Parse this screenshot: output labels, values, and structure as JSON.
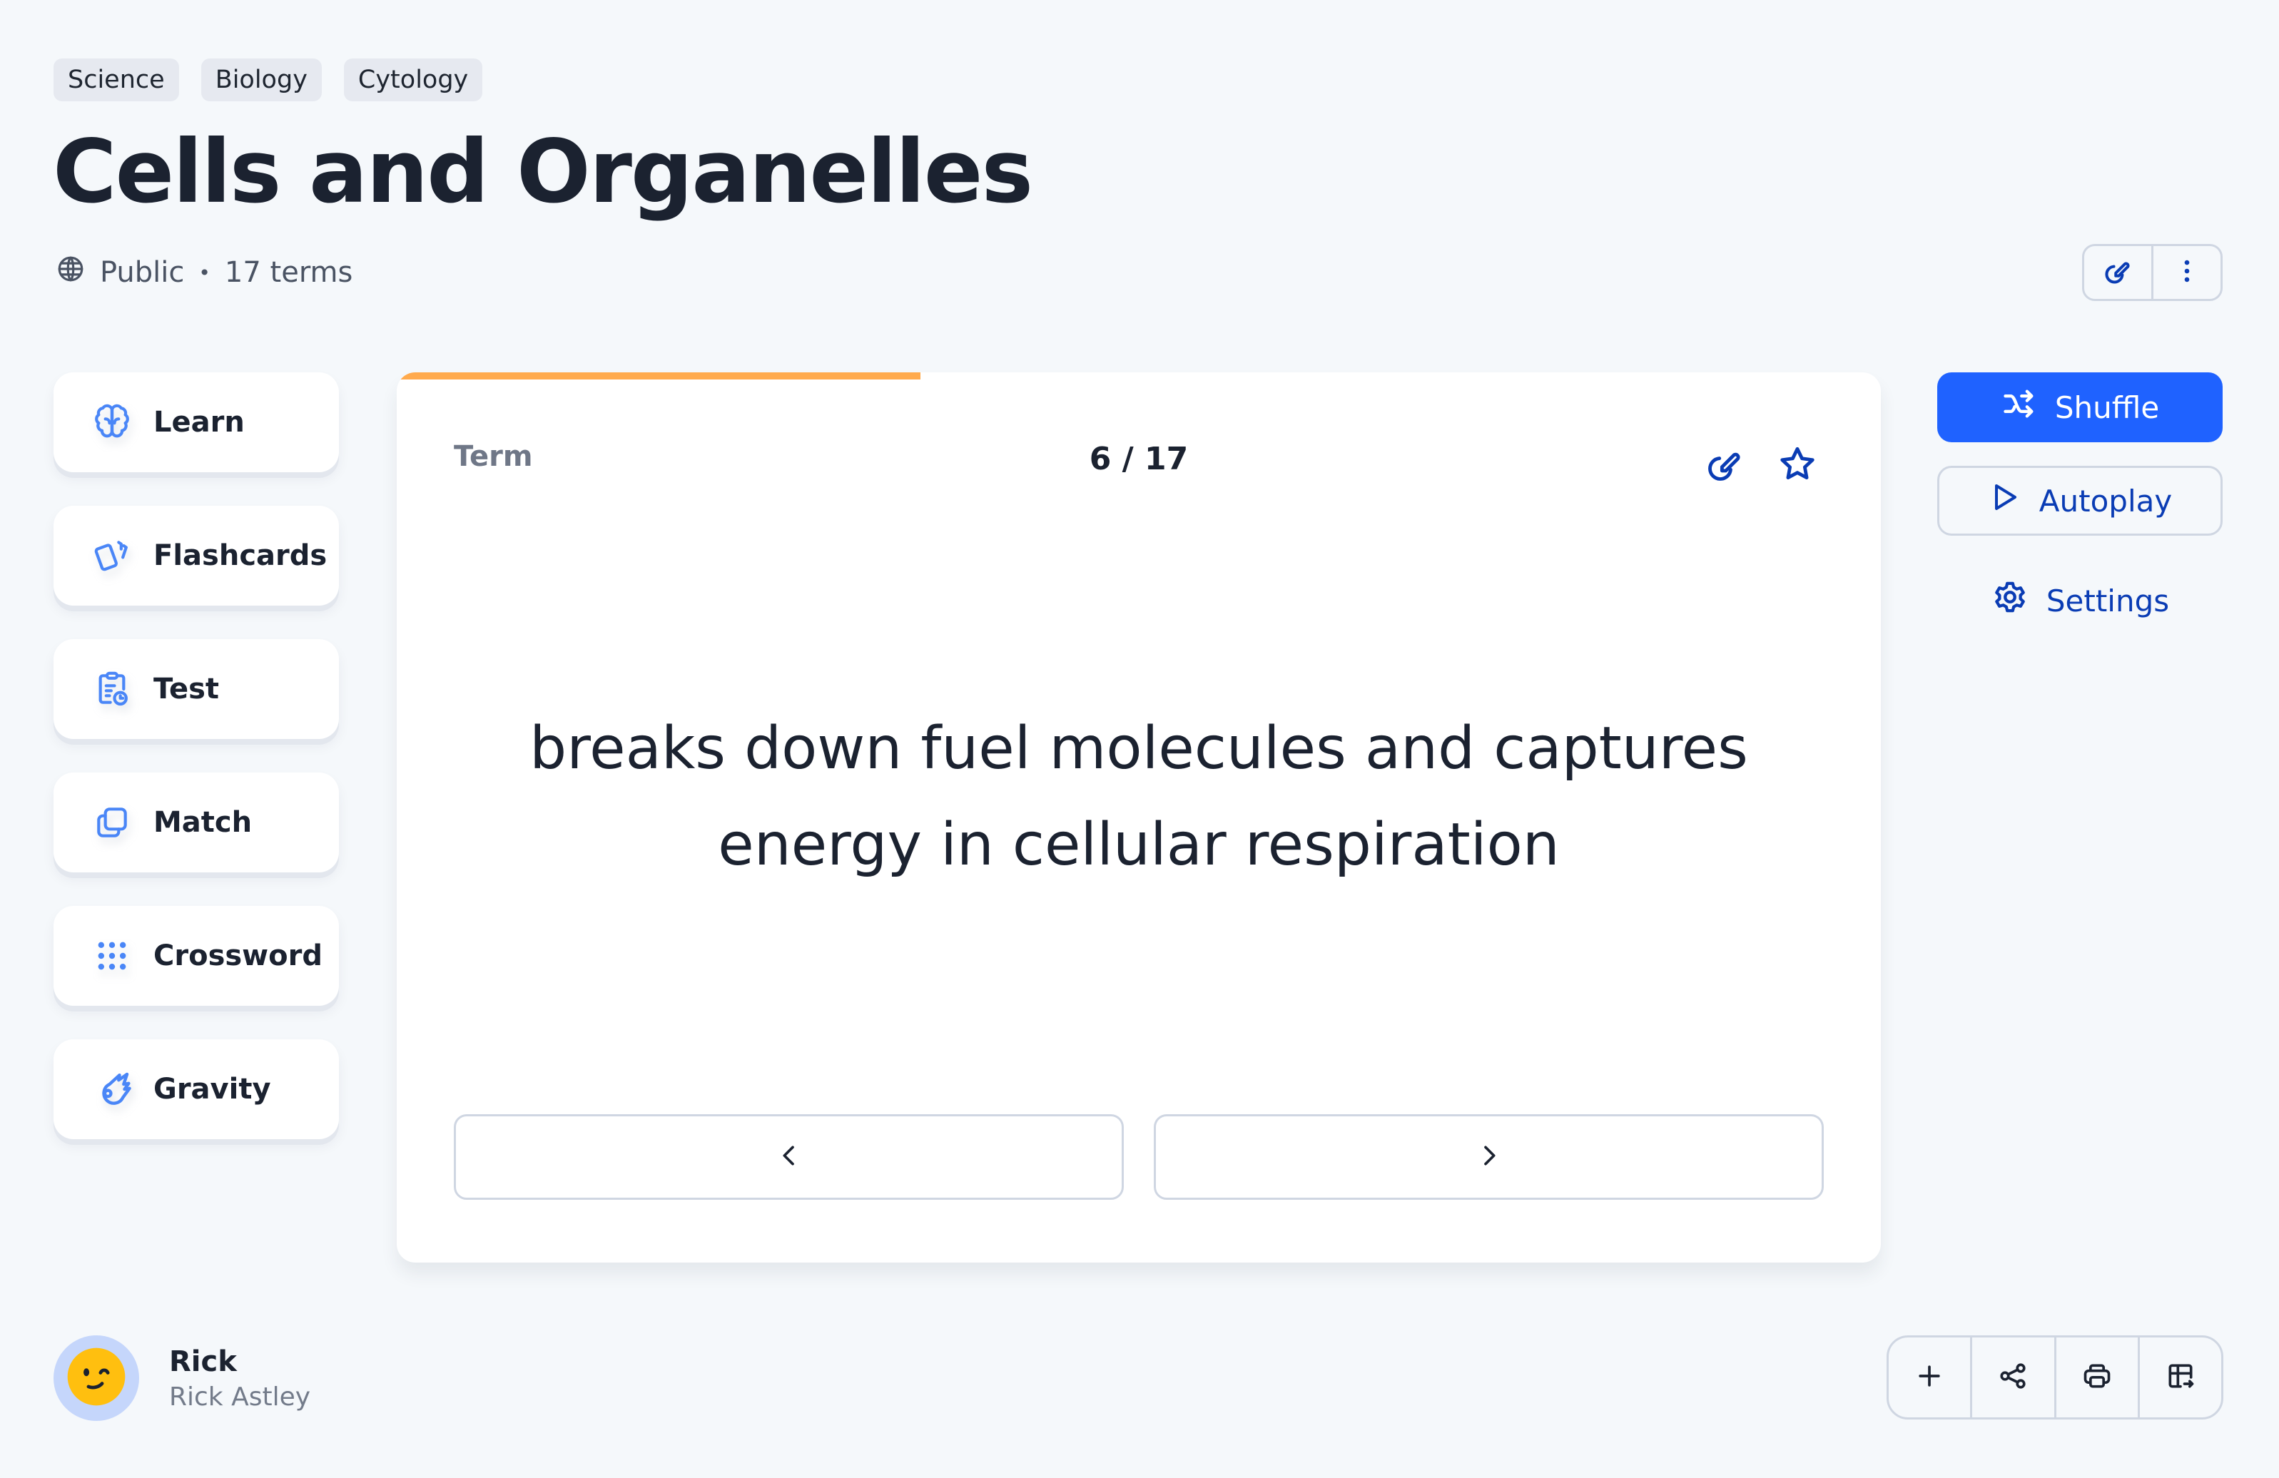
{
  "tags": [
    "Science",
    "Biology",
    "Cytology"
  ],
  "title": "Cells and Organelles",
  "meta": {
    "visibility_icon": "globe-icon",
    "visibility": "Public",
    "separator": "•",
    "term_count": "17 terms"
  },
  "header_actions": [
    {
      "name": "edit",
      "icon": "edit-pencil-icon"
    },
    {
      "name": "more",
      "icon": "more-vertical-icon"
    }
  ],
  "sidebar": {
    "items": [
      {
        "label": "Learn",
        "icon": "brain-icon"
      },
      {
        "label": "Flashcards",
        "icon": "flashcards-icon"
      },
      {
        "label": "Test",
        "icon": "clipboard-clock-icon"
      },
      {
        "label": "Match",
        "icon": "copy-squares-icon"
      },
      {
        "label": "Crossword",
        "icon": "dot-grid-icon"
      },
      {
        "label": "Gravity",
        "icon": "meteor-icon"
      }
    ]
  },
  "card": {
    "side_label": "Term",
    "counter": "6 / 17",
    "current": 6,
    "total": 17,
    "progress_fraction": 0.353,
    "text": "breaks down fuel molecules and captures energy in cellular respiration",
    "actions": [
      {
        "name": "edit",
        "icon": "edit-pencil-icon"
      },
      {
        "name": "star",
        "icon": "star-icon"
      }
    ],
    "nav": {
      "prev_icon": "chevron-left-icon",
      "next_icon": "chevron-right-icon"
    }
  },
  "controls": {
    "shuffle_label": "Shuffle",
    "autoplay_label": "Autoplay",
    "settings_label": "Settings"
  },
  "user": {
    "name": "Rick",
    "username": "Rick Astley",
    "avatar_icon": "winking-face-icon"
  },
  "toolbar": [
    {
      "name": "add",
      "icon": "plus-icon"
    },
    {
      "name": "share",
      "icon": "share-icon"
    },
    {
      "name": "print",
      "icon": "printer-icon"
    },
    {
      "name": "export",
      "icon": "table-export-icon"
    }
  ],
  "colors": {
    "background": "#f5f8fb",
    "primary": "#1f62ff",
    "primary_dark": "#0a3cb4",
    "progress": "#ffaa4d",
    "icon_blue": "#4a86f7",
    "text": "#1b2230",
    "muted": "#6f7787",
    "border": "#cfd6e2"
  }
}
